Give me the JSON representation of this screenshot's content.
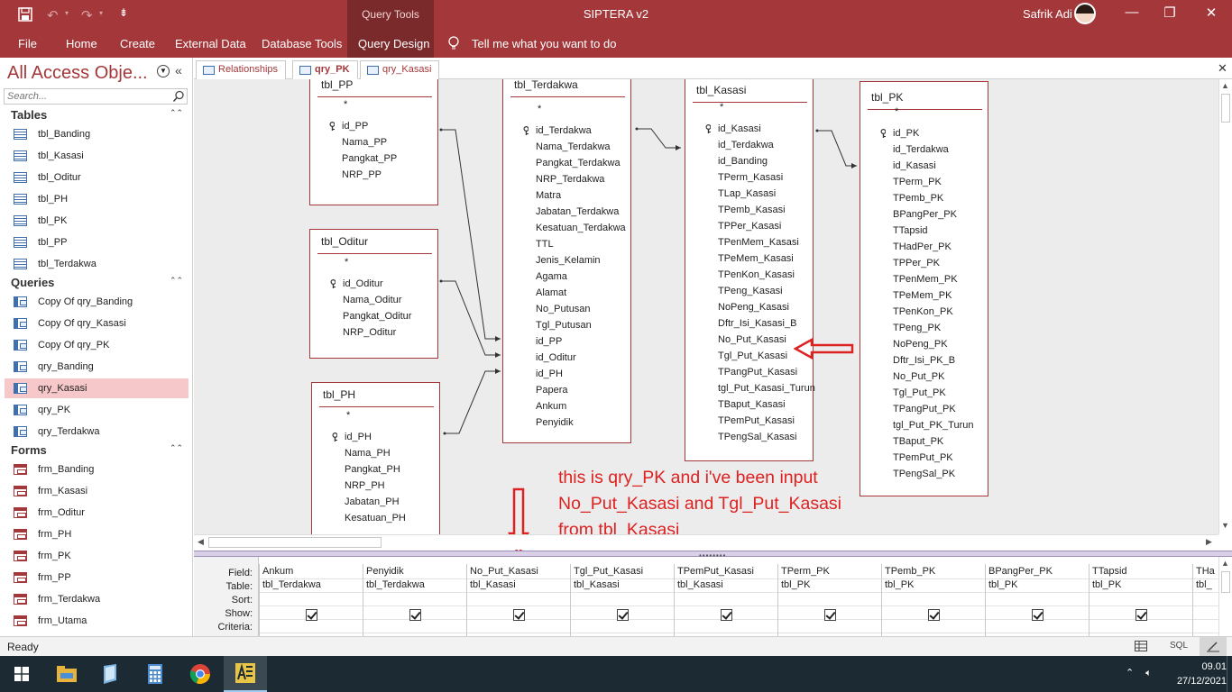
{
  "titlebar": {
    "context_label": "Query Tools",
    "app_title": "SIPTERA v2",
    "user_name": "Safrik Adi",
    "close_icon": "close-icon",
    "minimize_icon": "minimize-icon",
    "restore_icon": "restore-icon"
  },
  "ribbon": {
    "tabs": [
      "File",
      "Home",
      "Create",
      "External Data",
      "Database Tools",
      "Query Design"
    ],
    "tell_me": "Tell me what you want to do",
    "accent": "#a4373a",
    "context_color": "#7b2a2c"
  },
  "nav": {
    "title": "All Access Obje...",
    "search_placeholder": "Search...",
    "groups": [
      {
        "name": "Tables",
        "items": [
          "tbl_Banding",
          "tbl_Kasasi",
          "tbl_Oditur",
          "tbl_PH",
          "tbl_PK",
          "tbl_PP",
          "tbl_Terdakwa"
        ]
      },
      {
        "name": "Queries",
        "items": [
          "Copy Of qry_Banding",
          "Copy Of qry_Kasasi",
          "Copy Of qry_PK",
          "qry_Banding",
          "qry_Kasasi",
          "qry_PK",
          "qry_Terdakwa"
        ]
      },
      {
        "name": "Forms",
        "items": [
          "frm_Banding",
          "frm_Kasasi",
          "frm_Oditur",
          "frm_PH",
          "frm_PK",
          "frm_PP",
          "frm_Terdakwa",
          "frm_Utama"
        ]
      }
    ],
    "selected": "qry_Kasasi"
  },
  "doc_tabs": [
    {
      "label": "Relationships"
    },
    {
      "label": "qry_PK",
      "active": true
    },
    {
      "label": "qry_Kasasi"
    }
  ],
  "tables": {
    "tbl_PP": {
      "title": "tbl_PP",
      "fields": [
        "*",
        "id_PP",
        "Nama_PP",
        "Pangkat_PP",
        "NRP_PP"
      ],
      "keys": [
        "id_PP"
      ]
    },
    "tbl_Oditur": {
      "title": "tbl_Oditur",
      "fields": [
        "*",
        "id_Oditur",
        "Nama_Oditur",
        "Pangkat_Oditur",
        "NRP_Oditur"
      ],
      "keys": [
        "id_Oditur"
      ]
    },
    "tbl_PH": {
      "title": "tbl_PH",
      "fields": [
        "*",
        "id_PH",
        "Nama_PH",
        "Pangkat_PH",
        "NRP_PH",
        "Jabatan_PH",
        "Kesatuan_PH"
      ],
      "keys": [
        "id_PH"
      ]
    },
    "tbl_Terdakwa": {
      "title": "tbl_Terdakwa",
      "fields": [
        "*",
        "id_Terdakwa",
        "Nama_Terdakwa",
        "Pangkat_Terdakwa",
        "NRP_Terdakwa",
        "Matra",
        "Jabatan_Terdakwa",
        "Kesatuan_Terdakwa",
        "TTL",
        "Jenis_Kelamin",
        "Agama",
        "Alamat",
        "No_Putusan",
        "Tgl_Putusan",
        "id_PP",
        "id_Oditur",
        "id_PH",
        "Papera",
        "Ankum",
        "Penyidik"
      ],
      "keys": [
        "id_Terdakwa"
      ]
    },
    "tbl_Kasasi": {
      "title": "tbl_Kasasi",
      "fields": [
        "*",
        "id_Kasasi",
        "id_Terdakwa",
        "id_Banding",
        "TPerm_Kasasi",
        "TLap_Kasasi",
        "TPemb_Kasasi",
        "TPPer_Kasasi",
        "TPenMem_Kasasi",
        "TPeMem_Kasasi",
        "TPenKon_Kasasi",
        "TPeng_Kasasi",
        "NoPeng_Kasasi",
        "Dftr_Isi_Kasasi_B",
        "No_Put_Kasasi",
        "Tgl_Put_Kasasi",
        "TPangPut_Kasasi",
        "tgl_Put_Kasasi_Turun",
        "TBaput_Kasasi",
        "TPemPut_Kasasi",
        "TPengSal_Kasasi"
      ],
      "keys": [
        "id_Kasasi"
      ]
    },
    "tbl_PK": {
      "title": "tbl_PK",
      "fields": [
        "*",
        "id_PK",
        "id_Terdakwa",
        "id_Kasasi",
        "TPerm_PK",
        "TPemb_PK",
        "BPangPer_PK",
        "TTapsid",
        "THadPer_PK",
        "TPPer_PK",
        "TPenMem_PK",
        "TPeMem_PK",
        "TPenKon_PK",
        "TPeng_PK",
        "NoPeng_PK",
        "Dftr_Isi_PK_B",
        "No_Put_PK",
        "Tgl_Put_PK",
        "TPangPut_PK",
        "tgl_Put_PK_Turun",
        "TBaput_PK",
        "TPemPut_PK",
        "TPengSal_PK"
      ],
      "keys": [
        "id_PK"
      ]
    }
  },
  "annotation": {
    "text": "this is qry_PK and i've been input\nNo_Put_Kasasi and Tgl_Put_Kasasi\nfrom tbl_Kasasi",
    "color": "#d22"
  },
  "grid": {
    "row_labels": [
      "Field:",
      "Table:",
      "Sort:",
      "Show:",
      "Criteria:"
    ],
    "columns": [
      {
        "field": "Ankum",
        "table": "tbl_Terdakwa",
        "show": true
      },
      {
        "field": "Penyidik",
        "table": "tbl_Terdakwa",
        "show": true
      },
      {
        "field": "No_Put_Kasasi",
        "table": "tbl_Kasasi",
        "show": true
      },
      {
        "field": "Tgl_Put_Kasasi",
        "table": "tbl_Kasasi",
        "show": true
      },
      {
        "field": "TPemPut_Kasasi",
        "table": "tbl_Kasasi",
        "show": true
      },
      {
        "field": "TPerm_PK",
        "table": "tbl_PK",
        "show": true
      },
      {
        "field": "TPemb_PK",
        "table": "tbl_PK",
        "show": true
      },
      {
        "field": "BPangPer_PK",
        "table": "tbl_PK",
        "show": true
      },
      {
        "field": "TTapsid",
        "table": "tbl_PK",
        "show": true
      },
      {
        "field": "THa",
        "table": "tbl_",
        "show": false
      }
    ]
  },
  "status": {
    "text": "Ready",
    "views": [
      "datasheet-view-icon",
      "SQL",
      "design-view-icon"
    ]
  },
  "taskbar": {
    "time": "09.01",
    "date": "27/12/2021",
    "apps": [
      "windows-start-icon",
      "file-explorer-icon",
      "notepad-icon",
      "calculator-icon",
      "chrome-icon",
      "access-app-icon"
    ]
  }
}
